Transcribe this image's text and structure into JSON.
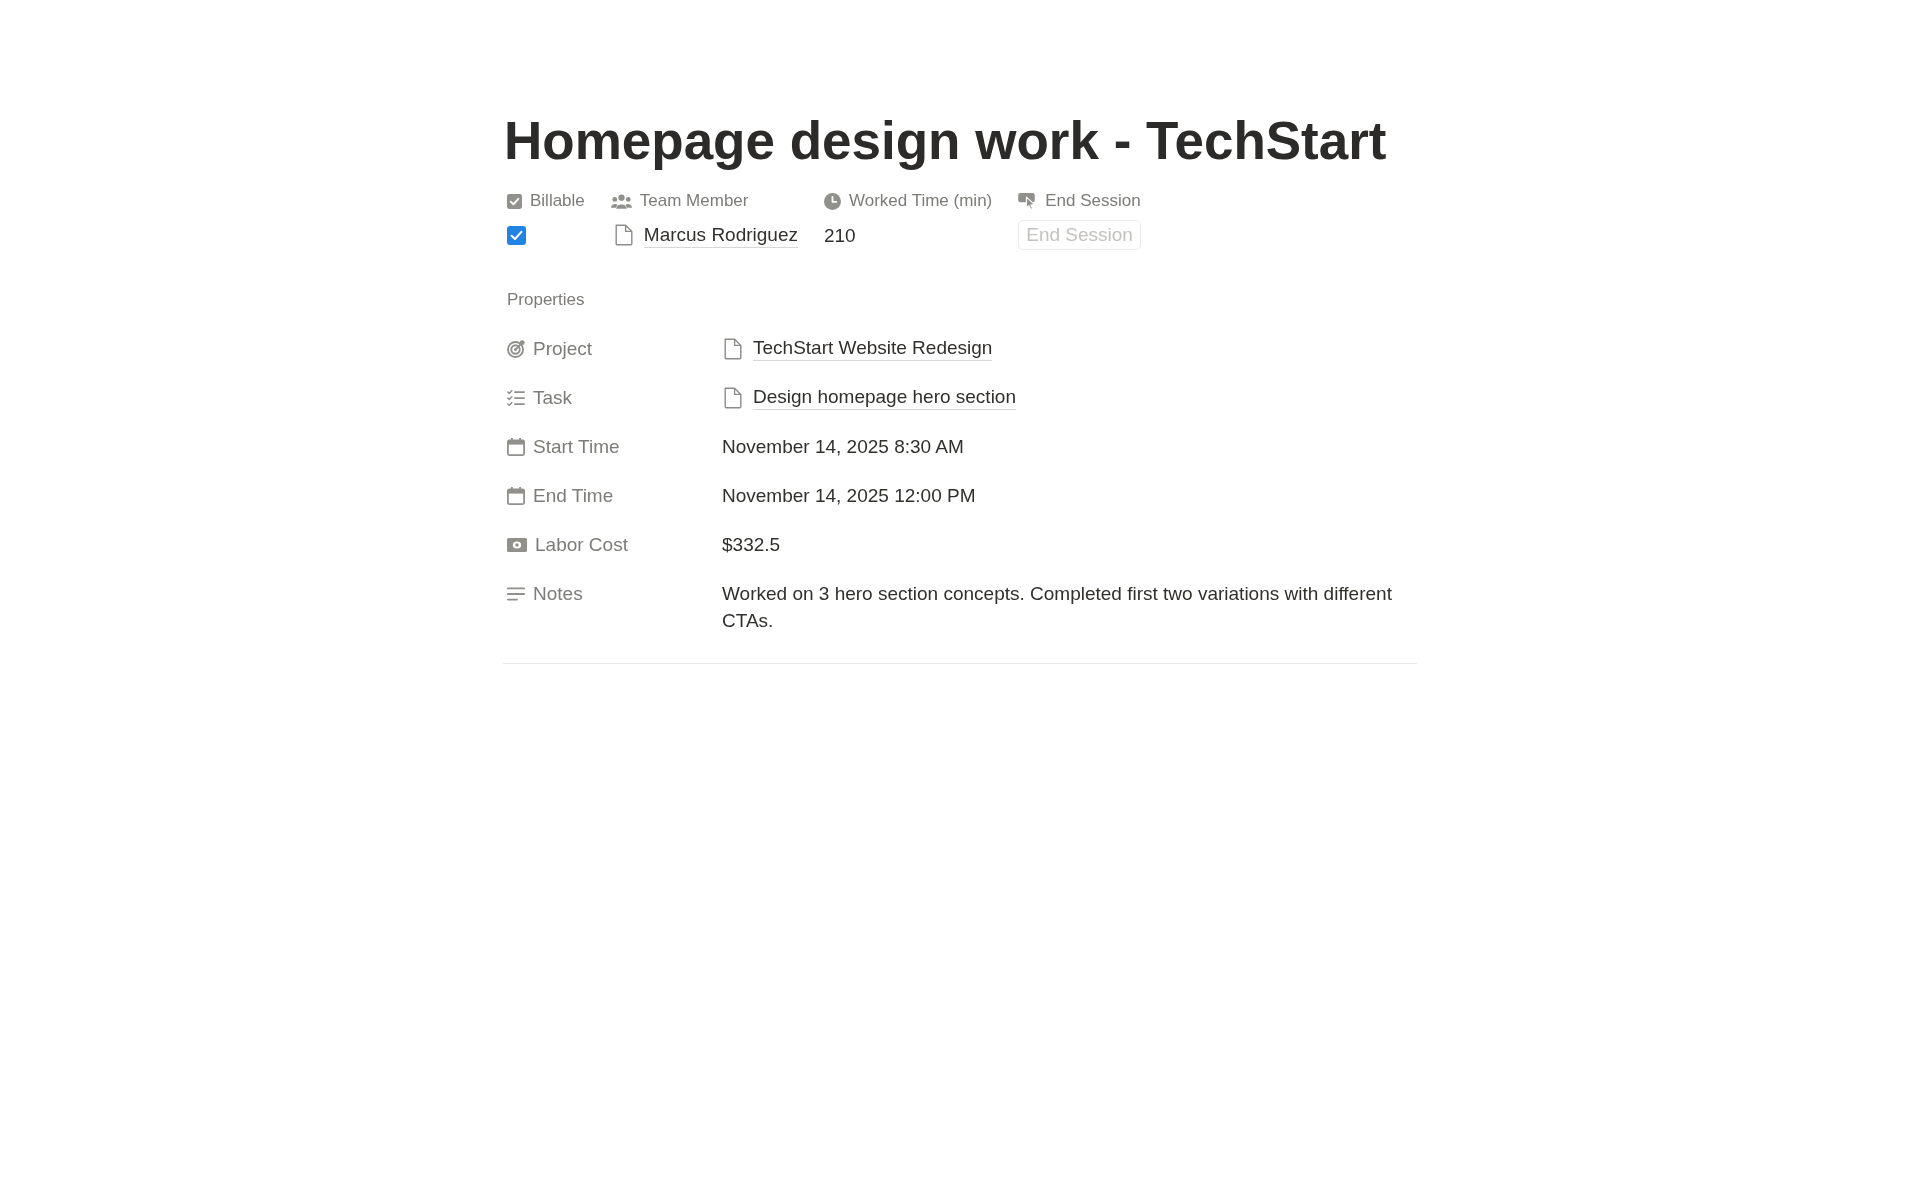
{
  "page": {
    "title": "Homepage design work - TechStart"
  },
  "header_properties": [
    {
      "kind": "checkbox",
      "label": "Billable",
      "checked": true
    },
    {
      "kind": "person",
      "label": "Team Member",
      "value": "Marcus Rodriguez"
    },
    {
      "kind": "number",
      "label": "Worked Time (min)",
      "value": "210"
    },
    {
      "kind": "button",
      "label": "End Session",
      "button": "End Session",
      "disabled": true
    }
  ],
  "properties": {
    "heading": "Properties",
    "rows": [
      {
        "kind": "relation",
        "label": "Project",
        "value": "TechStart Website Redesign"
      },
      {
        "kind": "relation",
        "label": "Task",
        "value": "Design homepage hero section"
      },
      {
        "kind": "date",
        "label": "Start Time",
        "value": "November 14, 2025 8:30 AM"
      },
      {
        "kind": "date",
        "label": "End Time",
        "value": "November 14, 2025 12:00 PM"
      },
      {
        "kind": "formula",
        "label": "Labor Cost",
        "value": "$332.5"
      },
      {
        "kind": "text",
        "label": "Notes",
        "value": "Worked on 3 hero section concepts. Completed first two variations with different CTAs."
      }
    ]
  }
}
